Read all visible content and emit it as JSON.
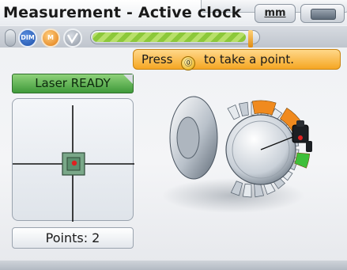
{
  "window": {
    "title": "Measurement - Active clock",
    "unit_label": "mm"
  },
  "statusbar": {
    "icons": [
      "dim-icon",
      "motor-icon",
      "verify-icon"
    ],
    "icon_labels": {
      "dim": "DIM",
      "m": "M"
    },
    "progress_fraction": 0.92
  },
  "hint": {
    "prefix": "Press",
    "key_symbol": "⓪",
    "suffix": "to take a point."
  },
  "laser": {
    "status": "Laser READY",
    "status_color": "#3f9a3a"
  },
  "target": {
    "crosshair_color": "#111111",
    "spot_color": "#e02020",
    "box_color": "#7aa889"
  },
  "points": {
    "label": "Points: 2"
  },
  "machine": {
    "taken_points": 2,
    "segment_color_taken": "#f08a1e",
    "segment_color_active": "#3fbf3a"
  }
}
